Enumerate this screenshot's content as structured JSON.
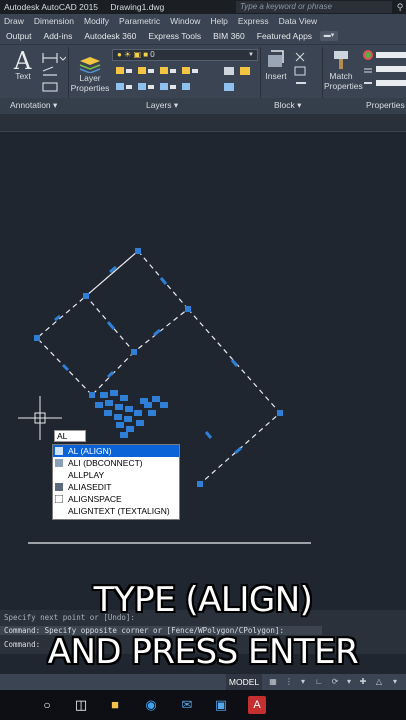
{
  "window": {
    "app_title": "Autodesk AutoCAD 2015",
    "file_name": "Drawing1.dwg",
    "search_placeholder": "Type a keyword or phrase"
  },
  "menu": [
    "Draw",
    "Dimension",
    "Modify",
    "Parametric",
    "Window",
    "Help",
    "Express",
    "Data View"
  ],
  "ribbon_tabs": [
    "Output",
    "Add-ins",
    "Autodesk 360",
    "Express Tools",
    "BIM 360",
    "Featured Apps"
  ],
  "ribbon": {
    "text_label": "Text",
    "layer_properties_label_1": "Layer",
    "layer_properties_label_2": "Properties",
    "layer_value": "0",
    "insert_label": "Insert",
    "match_label_1": "Match",
    "match_label_2": "Properties",
    "panels": {
      "annotation": "Annotation",
      "layers": "Layers",
      "block": "Block",
      "properties": "Properties"
    }
  },
  "command_input": "AL",
  "suggestions": [
    {
      "label": "AL (ALIGN)",
      "selected": true,
      "icon": "align-icon"
    },
    {
      "label": "ALI (DBCONNECT)",
      "selected": false,
      "icon": "dbconnect-icon"
    },
    {
      "label": "ALLPLAY",
      "selected": false,
      "icon": "blank-icon"
    },
    {
      "label": "ALIASEDIT",
      "selected": false,
      "icon": "aliasedit-icon"
    },
    {
      "label": "ALIGNSPACE",
      "selected": false,
      "icon": "alignspace-icon"
    },
    {
      "label": "ALIGNTEXT (TEXTALIGN)",
      "selected": false,
      "icon": "blank-icon"
    }
  ],
  "caption": {
    "line1": "TYPE (ALIGN)",
    "line2": "AND PRESS ENTER"
  },
  "command_history": [
    "Specify next point or [Undo]:",
    "Command: Specify opposite corner or [Fence/WPolygon/CPolygon]:",
    "Command:"
  ],
  "status": {
    "model_label": "MODEL"
  },
  "colors": {
    "accent": "#0a64d8",
    "grip": "#2f7fd6",
    "canvas": "#1f2630"
  }
}
